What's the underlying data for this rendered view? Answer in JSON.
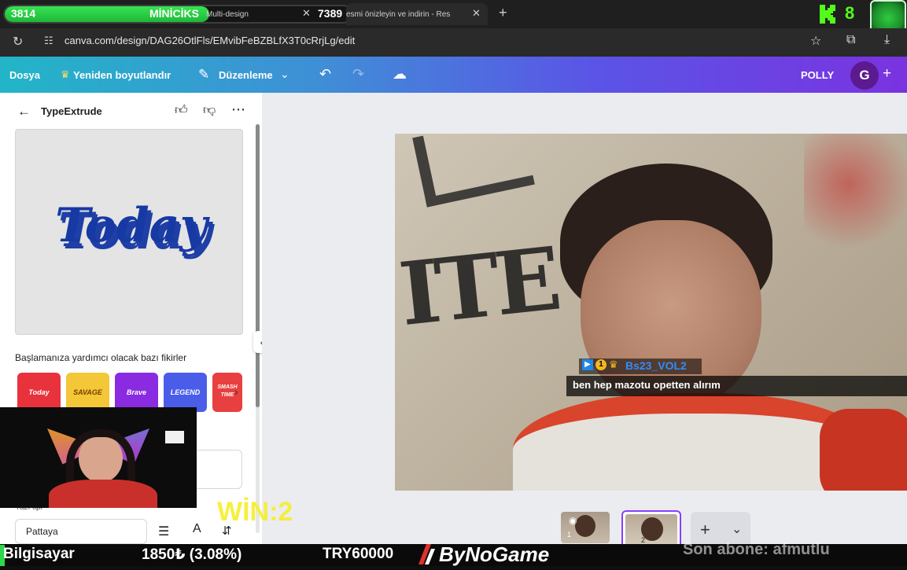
{
  "browser": {
    "tabs": [
      {
        "label": "Multi-design"
      },
      {
        "label": "esmi önizleyin ve indirin - Res"
      }
    ],
    "new_tab_glyph": "+",
    "url": "canva.com/design/DAG26OtlFls/EMvibFeBZBLfX3T0cRrjLg/edit"
  },
  "overlay": {
    "hp_left": "3814",
    "name": "MİNİCİKS",
    "hp_right": "7389",
    "kick_count": "8",
    "win_label": "WİN:2",
    "subscriber_label": "Son abone: afmutlu",
    "chat": {
      "user": "Bs23_VOL2",
      "badge_number": "1",
      "message": "ben hep mazotu opetten alırım"
    }
  },
  "toolbar": {
    "file": "Dosya",
    "resize": "Yeniden boyutlandır",
    "edit": "Düzenleme",
    "project": "POLLY",
    "avatar_letter": "G",
    "add": "+"
  },
  "panel": {
    "title": "TypeExtrude",
    "preview_word": "Today",
    "ideas_heading": "Başlamanıza yardımcı olacak bazı fikirler",
    "ideas": [
      {
        "label": "Today",
        "color": "#e8323c"
      },
      {
        "label": "SAVAGE",
        "color": "#f3c737"
      },
      {
        "label": "Brave",
        "color": "#8a2be2"
      },
      {
        "label": "LEGEND",
        "color": "#4a5de8"
      },
      {
        "label": "SMASH TIME",
        "color": "#e84040"
      }
    ],
    "font_label": "Yazı tipi",
    "font_value": "Pattaya"
  },
  "pages": [
    {
      "number": "1"
    },
    {
      "number": "2"
    }
  ],
  "ticker": {
    "computer": "Bilgisayar",
    "price": "1850₺ (3.08%)",
    "goal": "TRY60000",
    "brand": "ByNoGame"
  },
  "colors": {
    "accent": "#8b3dff",
    "hp_green": "#2bd94a",
    "kick_green": "#53fc18",
    "win_yellow": "#f5ef2a"
  }
}
